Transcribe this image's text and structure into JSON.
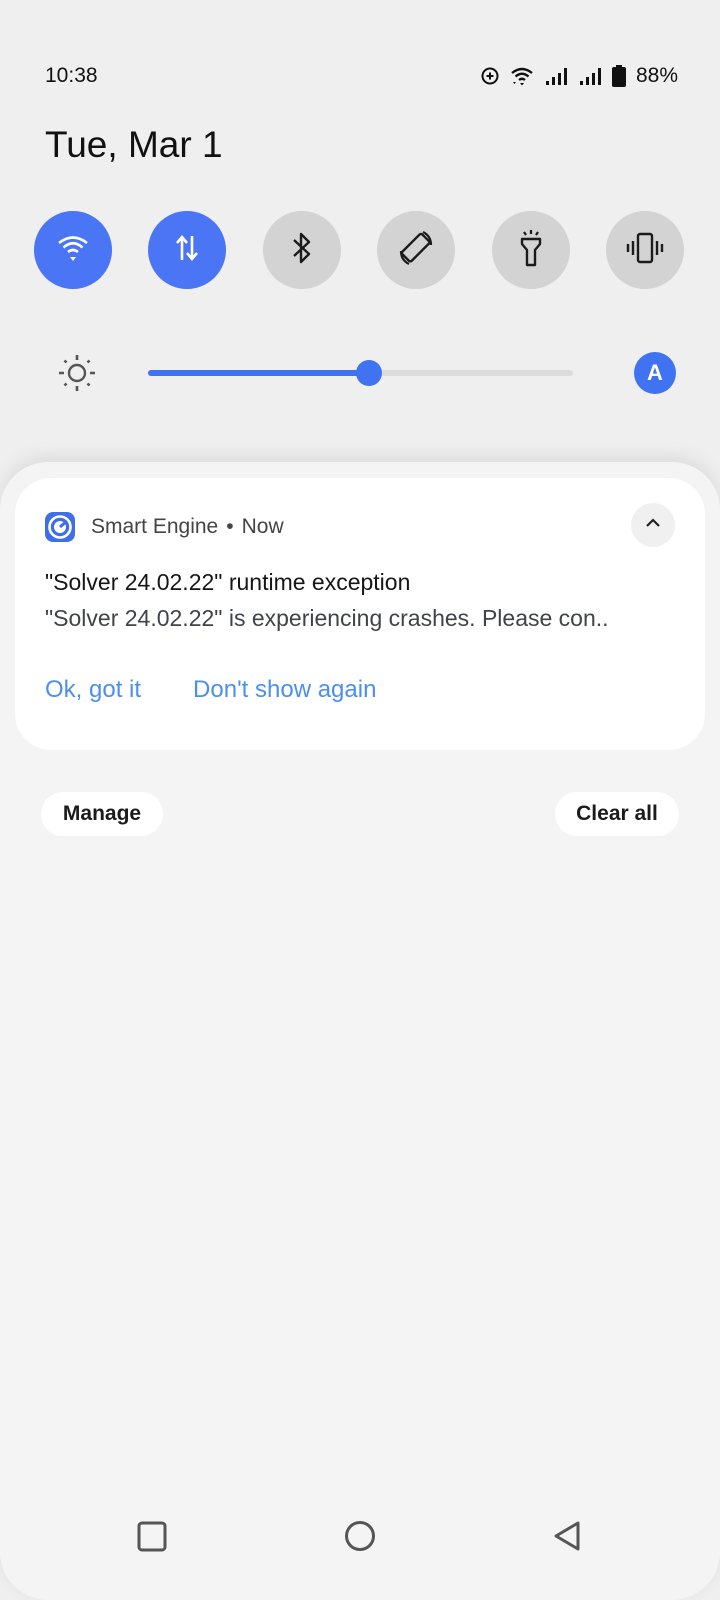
{
  "status_bar": {
    "time": "10:38",
    "icons": [
      "alarm-add-icon",
      "wifi-icon",
      "signal-icon-1",
      "signal-icon-2",
      "battery-icon"
    ],
    "battery_percent": "88%"
  },
  "header": {
    "date": "Tue, Mar 1"
  },
  "quick_tiles": [
    {
      "name": "wifi",
      "icon": "wifi-icon",
      "active": true
    },
    {
      "name": "mobile-data",
      "icon": "data-transfer-icon",
      "active": true
    },
    {
      "name": "bluetooth",
      "icon": "bluetooth-icon",
      "active": false
    },
    {
      "name": "auto-rotate",
      "icon": "rotate-icon",
      "active": false
    },
    {
      "name": "flashlight",
      "icon": "flashlight-icon",
      "active": false
    },
    {
      "name": "vibrate",
      "icon": "vibrate-icon",
      "active": false
    }
  ],
  "brightness": {
    "level": 0.52,
    "auto_label": "A"
  },
  "notification": {
    "app_name": "Smart Engine",
    "separator": "•",
    "time": "Now",
    "title": "\"Solver 24.02.22\" runtime exception",
    "body": "\"Solver 24.02.22\" is experiencing crashes. Please con..",
    "actions": [
      "Ok, got it",
      "Don't show again"
    ]
  },
  "footer_buttons": {
    "manage": "Manage",
    "clear_all": "Clear all"
  },
  "colors": {
    "accent": "#4a75f5",
    "action_link": "#4b8ff0"
  }
}
